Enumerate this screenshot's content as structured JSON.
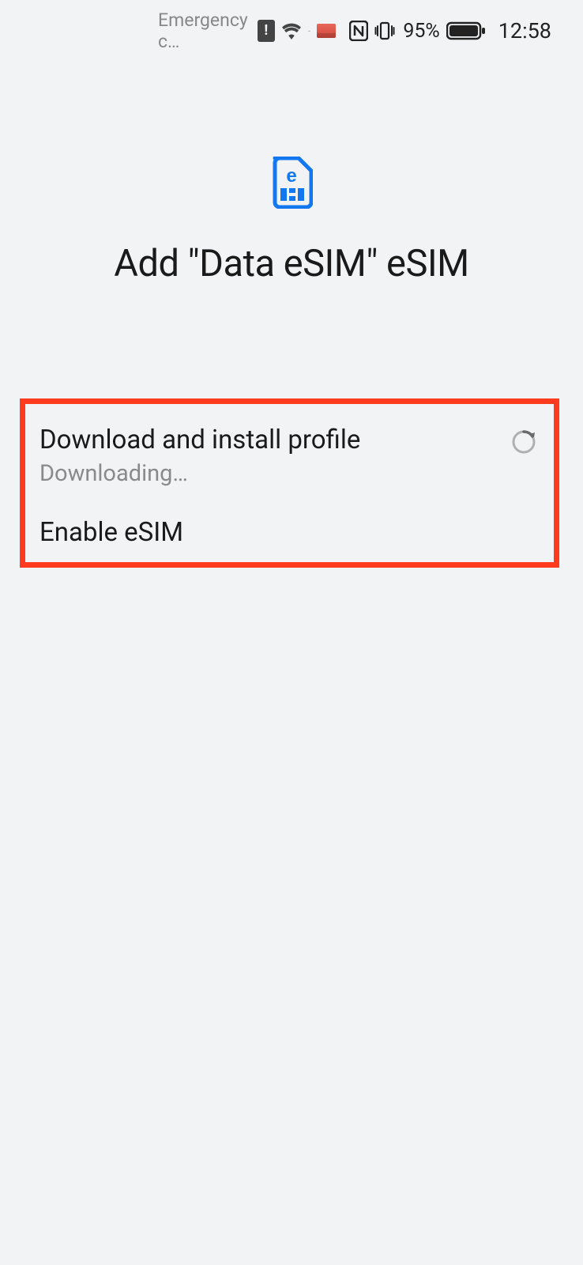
{
  "status_bar": {
    "carrier_text": "Emergency c…",
    "battery_percent": "95%",
    "time": "12:58"
  },
  "header": {
    "title": "Add \"Data eSIM\" eSIM"
  },
  "steps": {
    "download": {
      "title": "Download and install profile",
      "subtitle": "Downloading…"
    },
    "enable": {
      "title": "Enable eSIM"
    }
  }
}
